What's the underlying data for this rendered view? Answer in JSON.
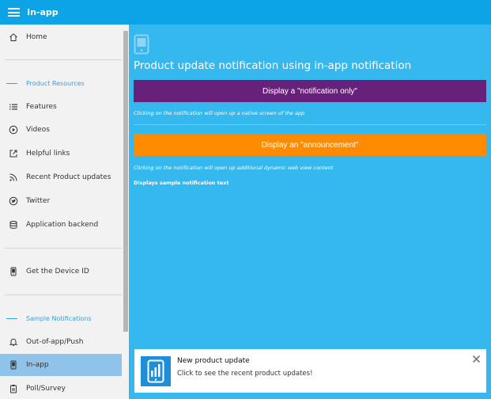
{
  "app": {
    "title": "In-app"
  },
  "sidebar": {
    "home": "Home",
    "section_product": "Product Resources",
    "features": "Features",
    "videos": "Videos",
    "helpful_links": "Helpful links",
    "recent_updates": "Recent Product updates",
    "twitter": "Twitter",
    "app_backend": "Application backend",
    "device_id": "Get the Device ID",
    "section_notifications": "Sample Notifications",
    "out_of_app": "Out-of-app/Push",
    "in_app": "In-app",
    "poll": "Poll/Survey"
  },
  "main": {
    "title": "Product update notification using in-app notification",
    "btn_notification_only": "Display a \"notification only\"",
    "hint_native": "Clicking on the notification will open up a native screen of the app",
    "btn_announcement": "Display an \"announcement\"",
    "hint_web": "Clicking on the notification will open up additional dynamic web view content",
    "note": "Displays sample notification text"
  },
  "toast": {
    "title": "New product update",
    "body": "Click to see the recent product updates!"
  },
  "colors": {
    "topbar": "#0ca4e6",
    "main_bg": "#35b8ee",
    "purple_button": "#68217a",
    "orange_button": "#ff8c00",
    "active_item": "#8fc3e9",
    "section_accent": "#3aa0d8"
  },
  "icons": {
    "menu": "hamburger-icon",
    "home": "home-icon",
    "features": "list-icon",
    "videos": "play-circle-icon",
    "links": "external-link-icon",
    "updates": "rss-icon",
    "twitter": "twitter-icon",
    "backend": "database-icon",
    "device": "phone-icon",
    "bell": "bell-icon",
    "inapp": "phone-icon",
    "poll": "clipboard-icon",
    "close": "close-icon"
  }
}
